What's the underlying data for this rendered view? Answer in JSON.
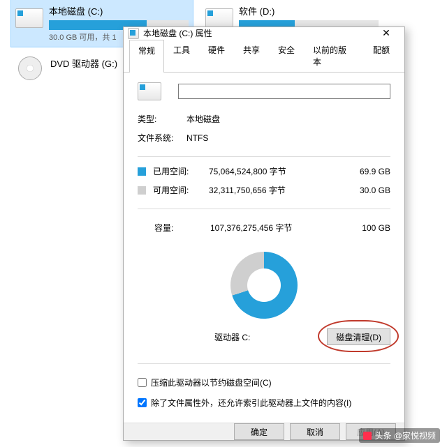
{
  "explorer": {
    "drives": [
      {
        "name": "本地磁盘 (C:)",
        "sub": "30.0 GB 可用，共 1",
        "fill_pct": 70,
        "selected": true
      },
      {
        "name": "软件 (D:)",
        "sub": "",
        "fill_pct": 40,
        "selected": false
      }
    ],
    "dvd": {
      "name": "DVD 驱动器 (G:)"
    }
  },
  "dialog": {
    "title": "本地磁盘 (C:) 属性",
    "tabs": [
      "常规",
      "工具",
      "硬件",
      "共享",
      "安全",
      "以前的版本",
      "配额"
    ],
    "active_tab": 0,
    "name_value": "",
    "type_label": "类型:",
    "type_value": "本地磁盘",
    "fs_label": "文件系统:",
    "fs_value": "NTFS",
    "used": {
      "label": "已用空间:",
      "bytes": "75,064,524,800 字节",
      "human": "69.9 GB",
      "color": "#26a0da"
    },
    "free": {
      "label": "可用空间:",
      "bytes": "32,311,750,656 字节",
      "human": "30.0 GB",
      "color": "#cfcfcf"
    },
    "capacity": {
      "label": "容量:",
      "bytes": "107,376,275,456 字节",
      "human": "100 GB"
    },
    "drive_name": "驱动器 C:",
    "cleanup_btn": "磁盘清理(D)",
    "compress_label": "压缩此驱动器以节约磁盘空间(C)",
    "compress_checked": false,
    "index_label": "除了文件属性外，还允许索引此驱动器上文件的内容(I)",
    "index_checked": true,
    "ok": "确定",
    "cancel": "取消",
    "apply": "应用(A)"
  },
  "watermark": "头条 @家悦视频"
}
